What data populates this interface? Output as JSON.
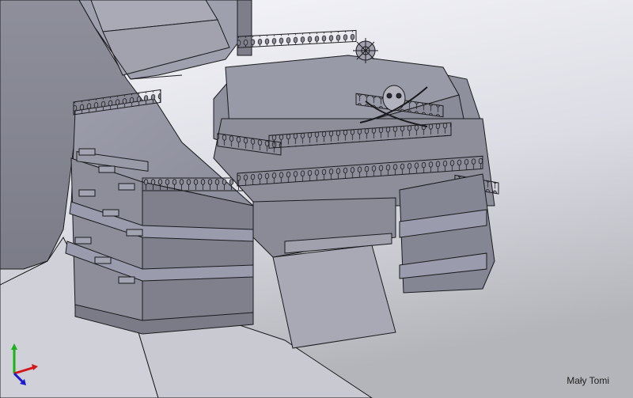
{
  "viewport": {
    "background_top": "#f3f3f9",
    "background_bottom": "#b8b9bf",
    "model_light": "#a7a8b2",
    "model_mid": "#8b8c98",
    "model_dark": "#6d6e79",
    "edge_color": "#1a1a1e"
  },
  "triad": {
    "x_axis_color": "#d11919",
    "y_axis_color": "#19b219",
    "z_axis_color": "#1a1acf"
  },
  "signature": {
    "text": "Mały Tomi"
  }
}
